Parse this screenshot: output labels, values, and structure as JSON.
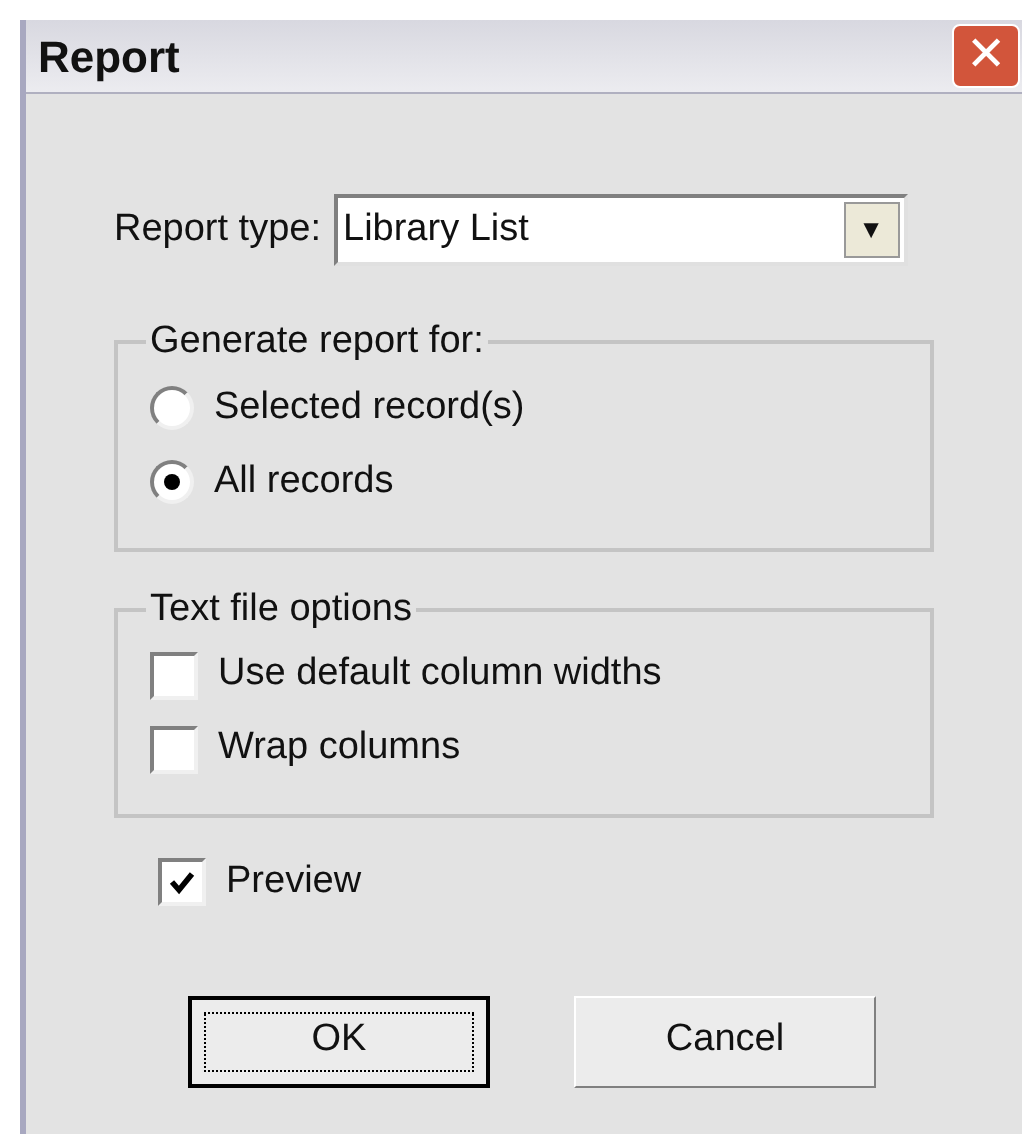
{
  "window": {
    "title": "Report",
    "close_label": "✕"
  },
  "report_type": {
    "label": "Report type:",
    "value": "Library List",
    "arrow": "▼"
  },
  "generate_group": {
    "legend": "Generate report for:",
    "options": [
      {
        "label": "Selected record(s)",
        "selected": false
      },
      {
        "label": "All records",
        "selected": true
      }
    ]
  },
  "text_file_group": {
    "legend": "Text file options",
    "options": [
      {
        "label": "Use default column widths",
        "checked": false
      },
      {
        "label": "Wrap columns",
        "checked": false
      }
    ]
  },
  "preview": {
    "label": "Preview",
    "checked": true
  },
  "buttons": [
    {
      "label": "OK",
      "default": true
    },
    {
      "label": "Cancel",
      "default": false
    }
  ]
}
